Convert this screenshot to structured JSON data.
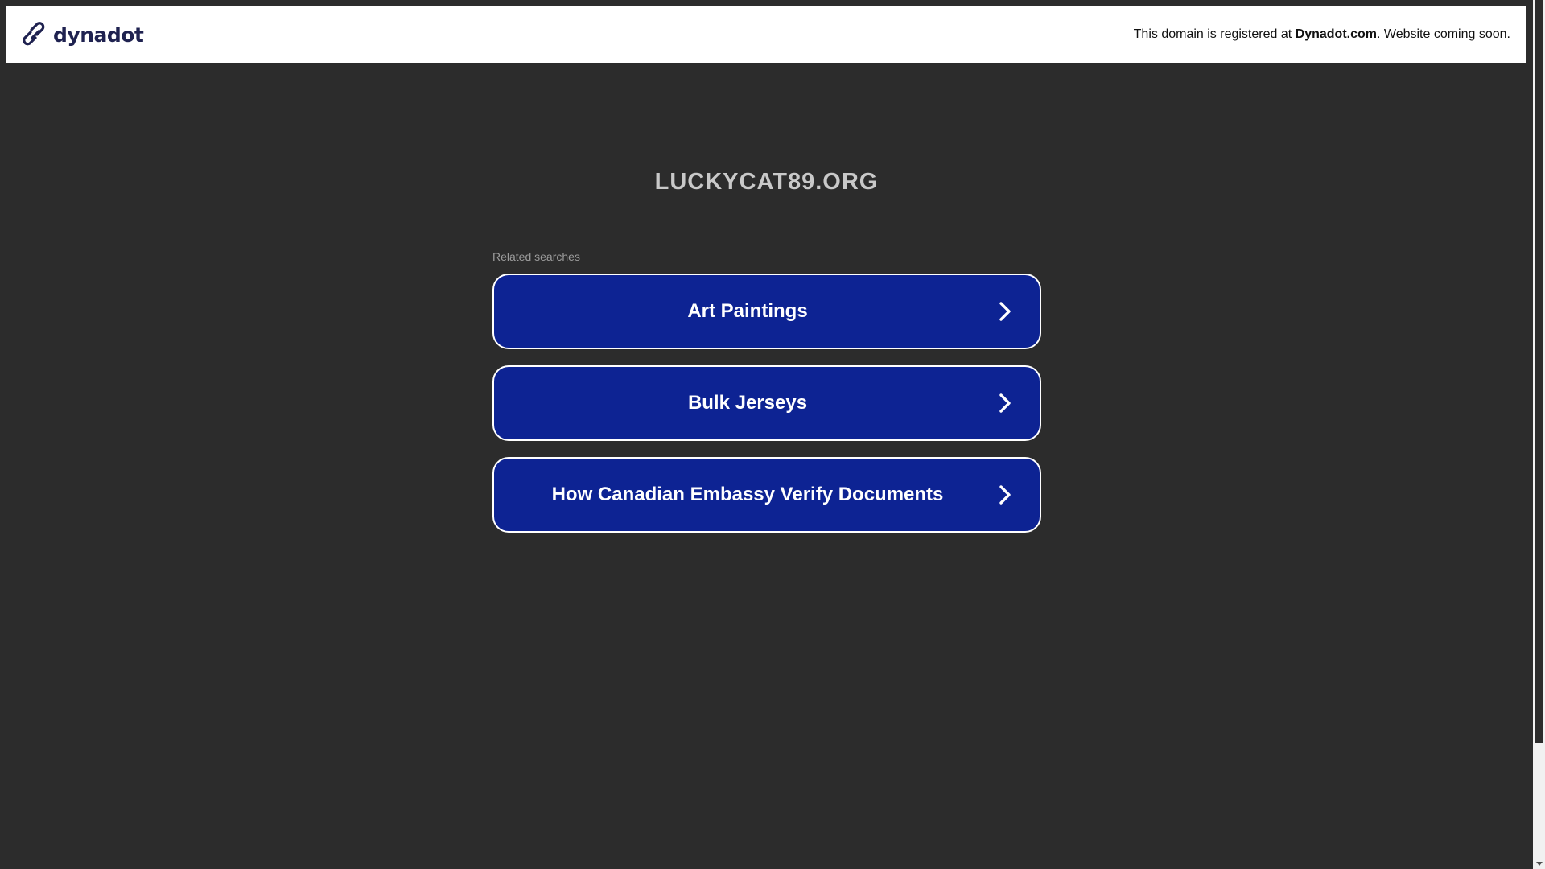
{
  "banner": {
    "logo_text": "dynadot",
    "logo_icon": "dynadot-link-icon",
    "message_prefix": "This domain is registered at ",
    "message_brand": "Dynadot.com",
    "message_suffix": ". Website coming soon."
  },
  "domain": "LUCKYCAT89.ORG",
  "related": {
    "label": "Related searches",
    "items": [
      {
        "label": "Art Paintings"
      },
      {
        "label": "Bulk Jerseys"
      },
      {
        "label": "How Canadian Embassy Verify Documents"
      }
    ]
  },
  "colors": {
    "background": "#2c2c2c",
    "button": "#0d2393",
    "button_border": "#ffffff",
    "banner": "#ffffff",
    "logo": "#1f2250"
  }
}
